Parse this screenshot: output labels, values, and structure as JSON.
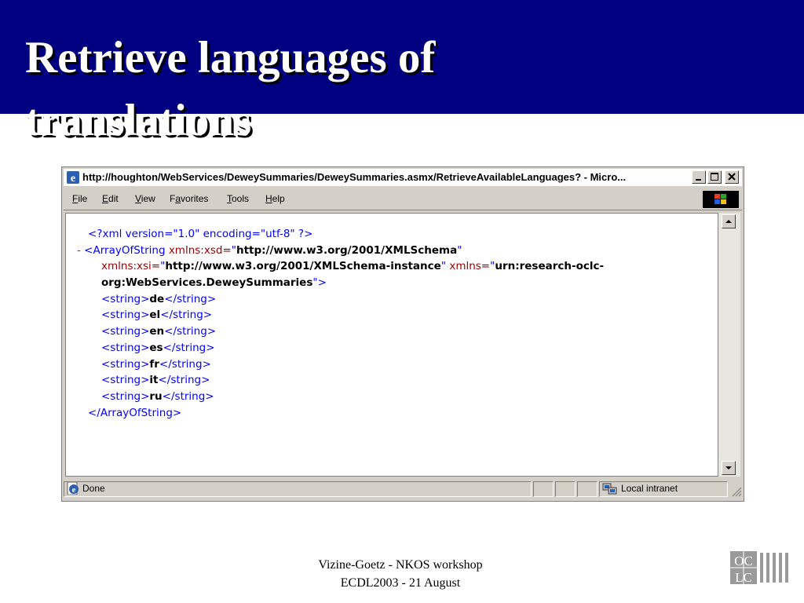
{
  "slide": {
    "title": "Retrieve languages of translations",
    "footer_line1": "Vizine-Goetz - NKOS workshop",
    "footer_line2": "ECDL2003 - 21 August",
    "logo_text_top": "OC",
    "logo_text_bottom": "LC"
  },
  "browser": {
    "title": "http://houghton/WebServices/DeweySummaries/DeweySummaries.asmx/RetrieveAvailableLanguages? - Micro...",
    "menu": [
      "File",
      "Edit",
      "View",
      "Favorites",
      "Tools",
      "Help"
    ],
    "menu_accel": [
      "F",
      "E",
      "V",
      "a",
      "T",
      "H"
    ],
    "xml": {
      "decl": "<?xml version=\"1.0\" encoding=\"utf-8\" ?>",
      "collapse": "-",
      "root_open": "<ArrayOfString",
      "xsd_attr": "xmlns:xsd=",
      "xsd_value": "http://www.w3.org/2001/XMLSchema",
      "xsi_attr": "xmlns:xsi=",
      "xsi_value": "http://www.w3.org/2001/XMLSchema-instance",
      "ns_attr": "xmlns=",
      "ns_value_part1": "urn:research-oclc-",
      "ns_value_part2": "org:WebServices.DeweySummaries",
      "open_tag": "<string>",
      "close_tag": "</string>",
      "languages": [
        "de",
        "el",
        "en",
        "es",
        "fr",
        "it",
        "ru"
      ],
      "root_close": "</ArrayOfString>"
    },
    "status": {
      "text": "Done",
      "zone": "Local intranet"
    },
    "colors": {
      "title_band": "#000080",
      "markup_blue": "#0000ff",
      "attr_red": "#990000",
      "value_bold": "#000000"
    }
  }
}
